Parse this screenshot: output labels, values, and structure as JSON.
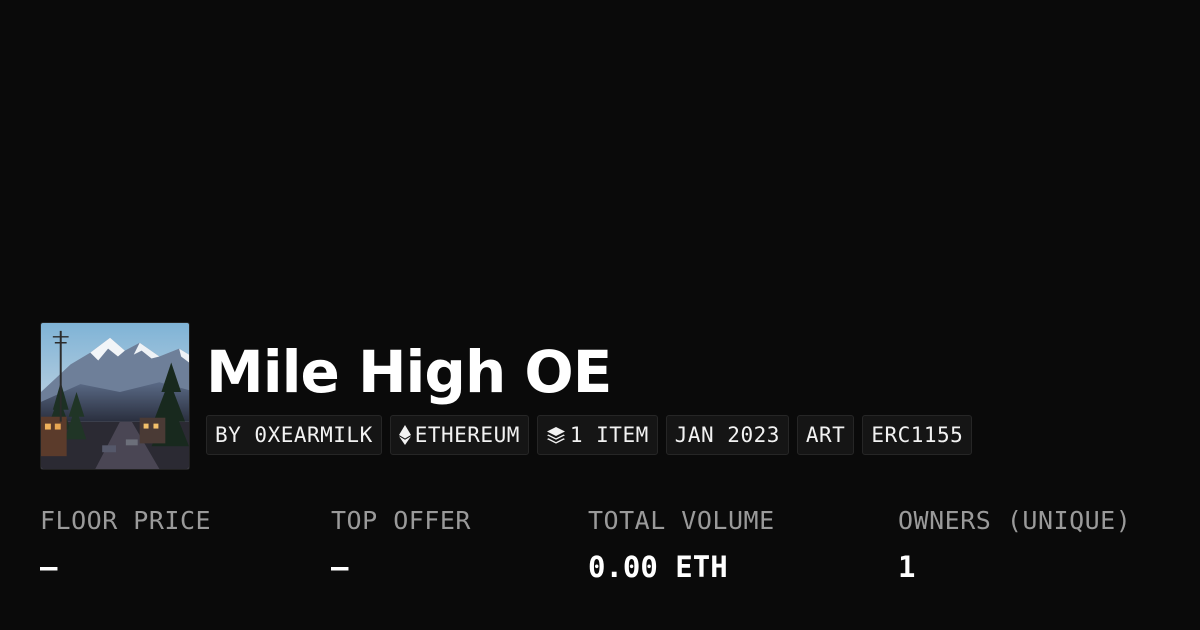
{
  "collection": {
    "title": "Mile High OE",
    "avatar_icon": "collection-thumbnail-mountain-town"
  },
  "tags": {
    "creator": "BY 0XEARMILK",
    "chain": "ETHEREUM",
    "chain_icon": "ethereum-icon",
    "items": "1 ITEM",
    "items_icon": "layers-icon",
    "date": "JAN 2023",
    "category": "ART",
    "standard": "ERC1155"
  },
  "stats": {
    "floor_price": {
      "label": "FLOOR PRICE",
      "value": "—"
    },
    "top_offer": {
      "label": "TOP OFFER",
      "value": "—"
    },
    "total_volume": {
      "label": "TOTAL VOLUME",
      "value": "0.00 ETH"
    },
    "owners": {
      "label": "OWNERS (UNIQUE)",
      "value": "1"
    }
  },
  "colors": {
    "background": "#0a0a0a",
    "tag_background": "#151515",
    "label_gray": "#9a9a9a",
    "text": "#ffffff"
  }
}
